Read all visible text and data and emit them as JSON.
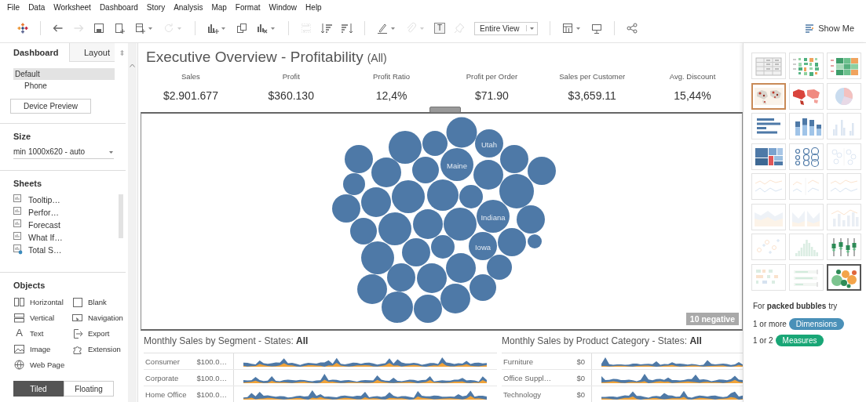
{
  "menu": [
    "File",
    "Data",
    "Worksheet",
    "Dashboard",
    "Story",
    "Analysis",
    "Map",
    "Format",
    "Window",
    "Help"
  ],
  "toolbar": {
    "items": [
      {
        "kind": "logo",
        "disabled": false
      },
      {
        "kind": "separator"
      },
      {
        "kind": "back",
        "disabled": false
      },
      {
        "kind": "forward",
        "disabled": true
      },
      {
        "kind": "save",
        "disabled": false
      },
      {
        "kind": "new-sheet",
        "disabled": false
      },
      {
        "kind": "new-dashboard",
        "disabled": false,
        "caret": true
      },
      {
        "kind": "refresh",
        "disabled": true,
        "caret": true
      },
      {
        "kind": "separator"
      },
      {
        "kind": "add-chart",
        "disabled": false,
        "caret": true
      },
      {
        "kind": "duplicate",
        "disabled": false
      },
      {
        "kind": "clear",
        "disabled": false,
        "caret": true
      },
      {
        "kind": "separator"
      },
      {
        "kind": "swap",
        "disabled": true
      },
      {
        "kind": "sort-asc",
        "disabled": false
      },
      {
        "kind": "sort-desc",
        "disabled": false
      },
      {
        "kind": "separator"
      },
      {
        "kind": "highlight",
        "disabled": false,
        "caret": true
      },
      {
        "kind": "clip",
        "disabled": true,
        "caret": true
      },
      {
        "kind": "text-label",
        "label": "T"
      },
      {
        "kind": "pin",
        "disabled": true
      },
      {
        "kind": "view-dropdown",
        "label": "Entire View"
      },
      {
        "kind": "separator"
      },
      {
        "kind": "show-cards",
        "disabled": false,
        "caret": true
      },
      {
        "kind": "presentation",
        "disabled": false
      },
      {
        "kind": "separator"
      },
      {
        "kind": "share",
        "disabled": false
      }
    ],
    "show_me_button": "Show Me"
  },
  "left_panel": {
    "tabs": [
      {
        "label": "Dashboard",
        "selected": true
      },
      {
        "label": "Layout",
        "selected": false
      }
    ],
    "devices": [
      {
        "label": "Default",
        "selected": true
      },
      {
        "label": "Phone",
        "selected": false
      }
    ],
    "device_preview_button": "Device Preview",
    "size": {
      "title": "Size",
      "value": "min 1000x620 - auto"
    },
    "sheets": {
      "title": "Sheets",
      "items": [
        {
          "label": "Tooltip…",
          "kind": "sheet"
        },
        {
          "label": "Perfor…",
          "kind": "sheet"
        },
        {
          "label": "Forecast",
          "kind": "sheet"
        },
        {
          "label": "What If…",
          "kind": "sheet"
        },
        {
          "label": "Total S…",
          "kind": "sheet-used"
        }
      ]
    },
    "objects": {
      "title": "Objects",
      "items": [
        {
          "label": "Horizontal",
          "kind": "horizontal"
        },
        {
          "label": "Blank",
          "kind": "blank"
        },
        {
          "label": "Vertical",
          "kind": "vertical"
        },
        {
          "label": "Navigation",
          "kind": "navigation"
        },
        {
          "label": "Text",
          "kind": "text",
          "glyph": "A"
        },
        {
          "label": "Export",
          "kind": "export"
        },
        {
          "label": "Image",
          "kind": "image"
        },
        {
          "label": "Extension",
          "kind": "extension"
        },
        {
          "label": "Web Page",
          "kind": "web-page"
        }
      ]
    },
    "layout_modes": [
      {
        "label": "Tiled",
        "selected": true
      },
      {
        "label": "Floating",
        "selected": false
      }
    ]
  },
  "dashboard": {
    "title": "Executive Overview - Profitability",
    "title_filter": "(All)",
    "kpis": [
      {
        "label": "Sales",
        "value": "$2.901.677"
      },
      {
        "label": "Profit",
        "value": "$360.130"
      },
      {
        "label": "Profit Ratio",
        "value": "12,4%"
      },
      {
        "label": "Profit per Order",
        "value": "$71.90"
      },
      {
        "label": "Sales per Customer",
        "value": "$3,659.11"
      },
      {
        "label": "Avg. Discount",
        "value": "15,44%"
      }
    ],
    "bubble_chart": {
      "labels": [
        "Utah",
        "Maine",
        "Indiana",
        "Iowa"
      ],
      "badge": "10 negative"
    },
    "panels": [
      {
        "title": "Monthly Sales by Segment - States: **All**",
        "rows": [
          {
            "label": "Consumer",
            "value": "$100.0…"
          },
          {
            "label": "Corporate",
            "value": "$100.0…"
          },
          {
            "label": "Home Office",
            "value": "$100.0…"
          }
        ]
      },
      {
        "title": "Monthly Sales by Product Category - States: **All**",
        "rows": [
          {
            "label": "Furniture",
            "value": "$0"
          },
          {
            "label": "Office Suppl…",
            "value": "$0"
          },
          {
            "label": "Technology",
            "value": "$0"
          }
        ]
      }
    ]
  },
  "show_me": {
    "thumbnails": [
      {
        "kind": "text-table",
        "disabled": false,
        "selected": false,
        "recommended": false
      },
      {
        "kind": "heat-map",
        "disabled": false,
        "selected": false,
        "recommended": false
      },
      {
        "kind": "highlight-table",
        "disabled": false,
        "selected": false,
        "recommended": false
      },
      {
        "kind": "symbol-map",
        "disabled": false,
        "selected": false,
        "recommended": true
      },
      {
        "kind": "filled-map",
        "disabled": false,
        "selected": false,
        "recommended": false
      },
      {
        "kind": "pie",
        "disabled": false,
        "selected": false,
        "recommended": false
      },
      {
        "kind": "hbar",
        "disabled": false,
        "selected": false,
        "recommended": false
      },
      {
        "kind": "stacked-bar",
        "disabled": false,
        "selected": false,
        "recommended": false
      },
      {
        "kind": "side-bar",
        "disabled": true,
        "selected": false,
        "recommended": false
      },
      {
        "kind": "treemap",
        "disabled": false,
        "selected": false,
        "recommended": false
      },
      {
        "kind": "circle-view",
        "disabled": false,
        "selected": false,
        "recommended": false
      },
      {
        "kind": "side-circle",
        "disabled": true,
        "selected": false,
        "recommended": false
      },
      {
        "kind": "line-continuous",
        "disabled": true,
        "selected": false,
        "recommended": false
      },
      {
        "kind": "line-discrete",
        "disabled": true,
        "selected": false,
        "recommended": false
      },
      {
        "kind": "dual-line",
        "disabled": true,
        "selected": false,
        "recommended": false
      },
      {
        "kind": "area-continuous",
        "disabled": true,
        "selected": false,
        "recommended": false
      },
      {
        "kind": "area-discrete",
        "disabled": true,
        "selected": false,
        "recommended": false
      },
      {
        "kind": "dual-combo",
        "disabled": true,
        "selected": false,
        "recommended": false
      },
      {
        "kind": "scatter",
        "disabled": true,
        "selected": false,
        "recommended": false
      },
      {
        "kind": "histogram",
        "disabled": true,
        "selected": false,
        "recommended": false
      },
      {
        "kind": "box-whisker",
        "disabled": false,
        "selected": false,
        "recommended": false
      },
      {
        "kind": "gantt",
        "disabled": true,
        "selected": false,
        "recommended": false
      },
      {
        "kind": "bullet",
        "disabled": true,
        "selected": false,
        "recommended": false
      },
      {
        "kind": "packed-bubbles",
        "disabled": false,
        "selected": true,
        "recommended": false
      }
    ],
    "hint": "For **packed bubbles** try",
    "requirements": [
      {
        "prefix": "1 or more",
        "pill": "Dimensions",
        "color": "#4a90b8"
      },
      {
        "prefix": "1 or 2",
        "pill": "Measures",
        "color": "#19a676"
      }
    ]
  }
}
